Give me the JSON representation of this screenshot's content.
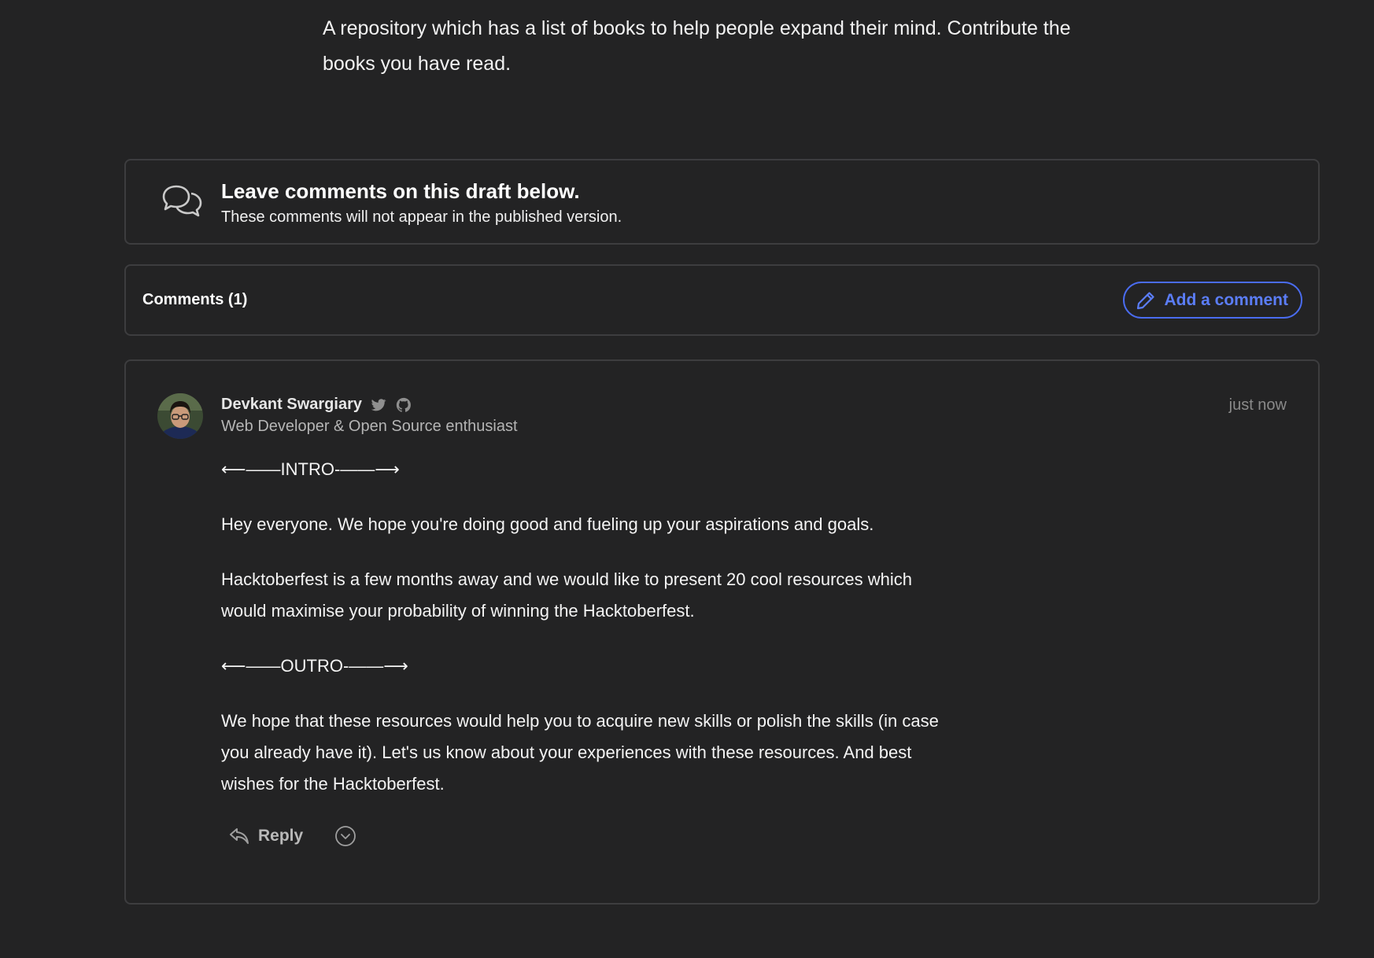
{
  "intro": {
    "text": "A repository which has a list of books to help people expand their mind. Contribute the books you have read."
  },
  "draft_notice": {
    "icon": "chat-bubbles-icon",
    "title": "Leave comments on this draft below.",
    "subtitle": "These comments will not appear in the published version."
  },
  "comments_bar": {
    "count_label": "Comments (1)",
    "add_comment_label": "Add a comment",
    "accent_color": "#4a6cf0"
  },
  "comment": {
    "author": "Devkant Swargiary",
    "tagline": "Web Developer & Open Source enthusiast",
    "timestamp": "just now",
    "social_icons": [
      "twitter-icon",
      "github-icon"
    ],
    "body": [
      "⟵——INTRO-——⟶",
      "Hey everyone. We hope you're doing good and fueling up your aspirations and goals.",
      "Hacktoberfest is a few months away and we would like to present 20 cool resources which would maximise your probability of winning the Hacktoberfest.",
      "⟵——OUTRO-——⟶",
      "We hope that these resources would help you to acquire new skills or polish the skills (in case you already have it). Let's us know about your experiences with these resources. And best wishes for the Hacktoberfest."
    ],
    "reply_label": "Reply"
  }
}
